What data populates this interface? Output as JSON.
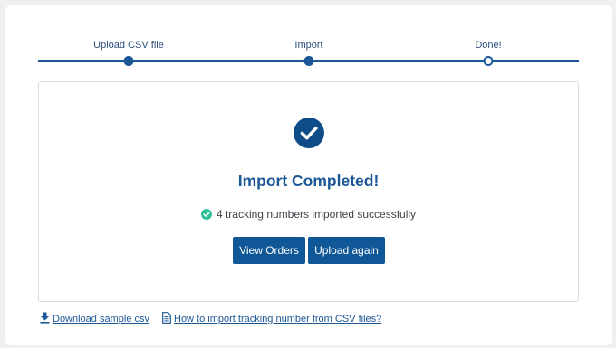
{
  "stepper": {
    "steps": [
      {
        "label": "Upload CSV file",
        "state": "done"
      },
      {
        "label": "Import",
        "state": "done"
      },
      {
        "label": "Done!",
        "state": "current"
      }
    ]
  },
  "result": {
    "icon": "check-circle-icon",
    "title": "Import Completed!",
    "status_icon": "success-check-icon",
    "status_text": "4 tracking numbers imported successfully",
    "buttons": {
      "view_orders": "View Orders",
      "upload_again": "Upload again"
    }
  },
  "links": {
    "download_sample": {
      "icon": "download-icon",
      "label": "Download sample csv"
    },
    "how_to": {
      "icon": "document-icon",
      "label": "How to import tracking number from CSV files?"
    }
  },
  "colors": {
    "primary": "#1c5796",
    "button": "#0f5796",
    "success": "#2fbf9b",
    "page_bg": "#f0f0f1"
  }
}
